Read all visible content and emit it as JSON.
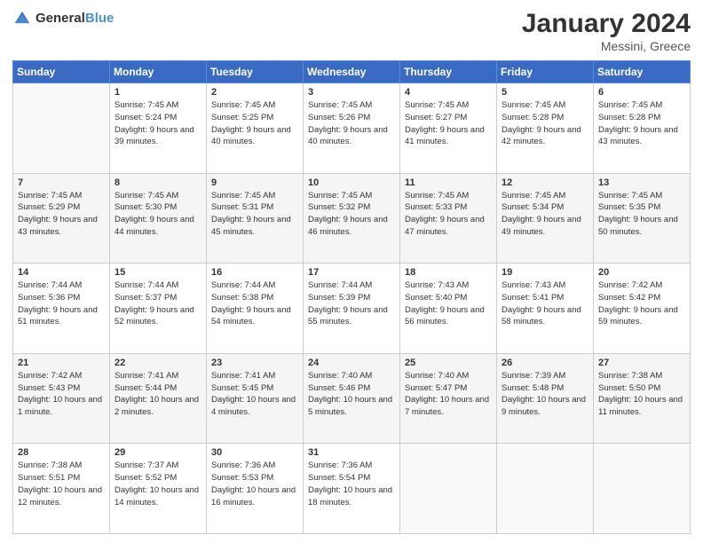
{
  "logo": {
    "general": "General",
    "blue": "Blue"
  },
  "header": {
    "month_year": "January 2024",
    "location": "Messini, Greece"
  },
  "weekdays": [
    "Sunday",
    "Monday",
    "Tuesday",
    "Wednesday",
    "Thursday",
    "Friday",
    "Saturday"
  ],
  "weeks": [
    [
      {
        "day": "",
        "sunrise": "",
        "sunset": "",
        "daylight": ""
      },
      {
        "day": "1",
        "sunrise": "Sunrise: 7:45 AM",
        "sunset": "Sunset: 5:24 PM",
        "daylight": "Daylight: 9 hours and 39 minutes."
      },
      {
        "day": "2",
        "sunrise": "Sunrise: 7:45 AM",
        "sunset": "Sunset: 5:25 PM",
        "daylight": "Daylight: 9 hours and 40 minutes."
      },
      {
        "day": "3",
        "sunrise": "Sunrise: 7:45 AM",
        "sunset": "Sunset: 5:26 PM",
        "daylight": "Daylight: 9 hours and 40 minutes."
      },
      {
        "day": "4",
        "sunrise": "Sunrise: 7:45 AM",
        "sunset": "Sunset: 5:27 PM",
        "daylight": "Daylight: 9 hours and 41 minutes."
      },
      {
        "day": "5",
        "sunrise": "Sunrise: 7:45 AM",
        "sunset": "Sunset: 5:28 PM",
        "daylight": "Daylight: 9 hours and 42 minutes."
      },
      {
        "day": "6",
        "sunrise": "Sunrise: 7:45 AM",
        "sunset": "Sunset: 5:28 PM",
        "daylight": "Daylight: 9 hours and 43 minutes."
      }
    ],
    [
      {
        "day": "7",
        "sunrise": "Sunrise: 7:45 AM",
        "sunset": "Sunset: 5:29 PM",
        "daylight": "Daylight: 9 hours and 43 minutes."
      },
      {
        "day": "8",
        "sunrise": "Sunrise: 7:45 AM",
        "sunset": "Sunset: 5:30 PM",
        "daylight": "Daylight: 9 hours and 44 minutes."
      },
      {
        "day": "9",
        "sunrise": "Sunrise: 7:45 AM",
        "sunset": "Sunset: 5:31 PM",
        "daylight": "Daylight: 9 hours and 45 minutes."
      },
      {
        "day": "10",
        "sunrise": "Sunrise: 7:45 AM",
        "sunset": "Sunset: 5:32 PM",
        "daylight": "Daylight: 9 hours and 46 minutes."
      },
      {
        "day": "11",
        "sunrise": "Sunrise: 7:45 AM",
        "sunset": "Sunset: 5:33 PM",
        "daylight": "Daylight: 9 hours and 47 minutes."
      },
      {
        "day": "12",
        "sunrise": "Sunrise: 7:45 AM",
        "sunset": "Sunset: 5:34 PM",
        "daylight": "Daylight: 9 hours and 49 minutes."
      },
      {
        "day": "13",
        "sunrise": "Sunrise: 7:45 AM",
        "sunset": "Sunset: 5:35 PM",
        "daylight": "Daylight: 9 hours and 50 minutes."
      }
    ],
    [
      {
        "day": "14",
        "sunrise": "Sunrise: 7:44 AM",
        "sunset": "Sunset: 5:36 PM",
        "daylight": "Daylight: 9 hours and 51 minutes."
      },
      {
        "day": "15",
        "sunrise": "Sunrise: 7:44 AM",
        "sunset": "Sunset: 5:37 PM",
        "daylight": "Daylight: 9 hours and 52 minutes."
      },
      {
        "day": "16",
        "sunrise": "Sunrise: 7:44 AM",
        "sunset": "Sunset: 5:38 PM",
        "daylight": "Daylight: 9 hours and 54 minutes."
      },
      {
        "day": "17",
        "sunrise": "Sunrise: 7:44 AM",
        "sunset": "Sunset: 5:39 PM",
        "daylight": "Daylight: 9 hours and 55 minutes."
      },
      {
        "day": "18",
        "sunrise": "Sunrise: 7:43 AM",
        "sunset": "Sunset: 5:40 PM",
        "daylight": "Daylight: 9 hours and 56 minutes."
      },
      {
        "day": "19",
        "sunrise": "Sunrise: 7:43 AM",
        "sunset": "Sunset: 5:41 PM",
        "daylight": "Daylight: 9 hours and 58 minutes."
      },
      {
        "day": "20",
        "sunrise": "Sunrise: 7:42 AM",
        "sunset": "Sunset: 5:42 PM",
        "daylight": "Daylight: 9 hours and 59 minutes."
      }
    ],
    [
      {
        "day": "21",
        "sunrise": "Sunrise: 7:42 AM",
        "sunset": "Sunset: 5:43 PM",
        "daylight": "Daylight: 10 hours and 1 minute."
      },
      {
        "day": "22",
        "sunrise": "Sunrise: 7:41 AM",
        "sunset": "Sunset: 5:44 PM",
        "daylight": "Daylight: 10 hours and 2 minutes."
      },
      {
        "day": "23",
        "sunrise": "Sunrise: 7:41 AM",
        "sunset": "Sunset: 5:45 PM",
        "daylight": "Daylight: 10 hours and 4 minutes."
      },
      {
        "day": "24",
        "sunrise": "Sunrise: 7:40 AM",
        "sunset": "Sunset: 5:46 PM",
        "daylight": "Daylight: 10 hours and 5 minutes."
      },
      {
        "day": "25",
        "sunrise": "Sunrise: 7:40 AM",
        "sunset": "Sunset: 5:47 PM",
        "daylight": "Daylight: 10 hours and 7 minutes."
      },
      {
        "day": "26",
        "sunrise": "Sunrise: 7:39 AM",
        "sunset": "Sunset: 5:48 PM",
        "daylight": "Daylight: 10 hours and 9 minutes."
      },
      {
        "day": "27",
        "sunrise": "Sunrise: 7:38 AM",
        "sunset": "Sunset: 5:50 PM",
        "daylight": "Daylight: 10 hours and 11 minutes."
      }
    ],
    [
      {
        "day": "28",
        "sunrise": "Sunrise: 7:38 AM",
        "sunset": "Sunset: 5:51 PM",
        "daylight": "Daylight: 10 hours and 12 minutes."
      },
      {
        "day": "29",
        "sunrise": "Sunrise: 7:37 AM",
        "sunset": "Sunset: 5:52 PM",
        "daylight": "Daylight: 10 hours and 14 minutes."
      },
      {
        "day": "30",
        "sunrise": "Sunrise: 7:36 AM",
        "sunset": "Sunset: 5:53 PM",
        "daylight": "Daylight: 10 hours and 16 minutes."
      },
      {
        "day": "31",
        "sunrise": "Sunrise: 7:36 AM",
        "sunset": "Sunset: 5:54 PM",
        "daylight": "Daylight: 10 hours and 18 minutes."
      },
      {
        "day": "",
        "sunrise": "",
        "sunset": "",
        "daylight": ""
      },
      {
        "day": "",
        "sunrise": "",
        "sunset": "",
        "daylight": ""
      },
      {
        "day": "",
        "sunrise": "",
        "sunset": "",
        "daylight": ""
      }
    ]
  ]
}
